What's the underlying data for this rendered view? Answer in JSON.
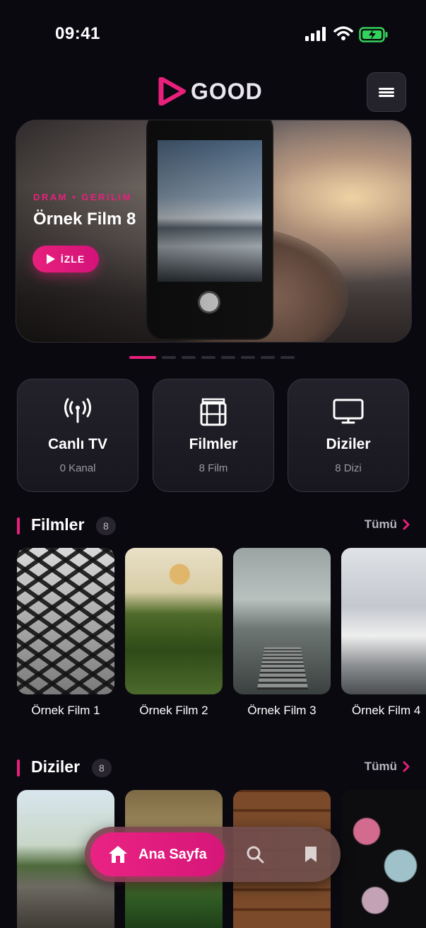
{
  "status_bar": {
    "time": "09:41"
  },
  "header": {
    "logo_text": "GOOD"
  },
  "hero": {
    "genre": "DRAM • GERILIM",
    "title": "Örnek Film 8",
    "play_label": "İZLE",
    "slide_count": 8,
    "active_slide": 1
  },
  "categories": [
    {
      "name": "Canlı TV",
      "count": "0 Kanal",
      "icon": "antenna-icon"
    },
    {
      "name": "Filmler",
      "count": "8 Film",
      "icon": "film-icon"
    },
    {
      "name": "Diziler",
      "count": "8 Dizi",
      "icon": "tv-icon"
    }
  ],
  "films": {
    "title": "Filmler",
    "count": "8",
    "see_all": "Tümü",
    "items": [
      "Örnek Film 1",
      "Örnek Film 2",
      "Örnek Film 3",
      "Örnek Film 4"
    ]
  },
  "series": {
    "title": "Diziler",
    "count": "8",
    "see_all": "Tümü"
  },
  "bottom_nav": {
    "home_label": "Ana Sayfa"
  },
  "colors": {
    "accent": "#e8207c",
    "background": "#0b0910"
  }
}
